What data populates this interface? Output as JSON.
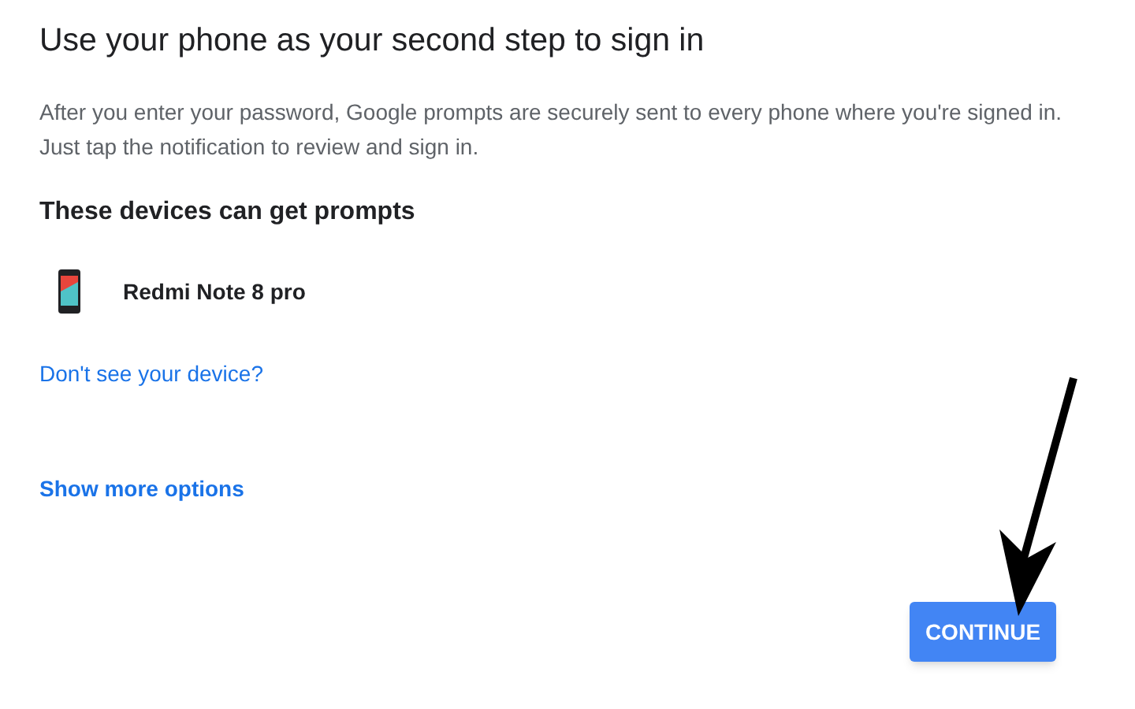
{
  "title": "Use your phone as your second step to sign in",
  "description": "After you enter your password, Google prompts are securely sent to every phone where you're signed in. Just tap the notification to review and sign in.",
  "devices_heading": "These devices can get prompts",
  "devices": [
    {
      "name": "Redmi Note 8 pro"
    }
  ],
  "links": [
    "Don't see your device?",
    "Show more options"
  ],
  "continue_button": "CONTINUE"
}
